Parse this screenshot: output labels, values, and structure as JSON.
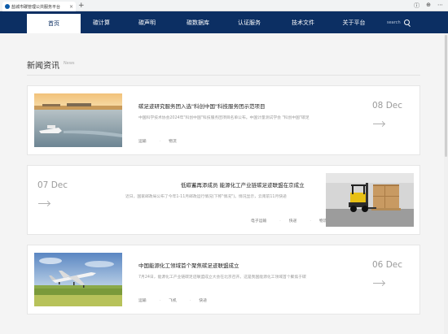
{
  "browser": {
    "tab_title": "盐城市碳管理公共服务平台",
    "tab_close": "×",
    "new_tab": "+",
    "icons": [
      "info-icon",
      "globe-icon",
      "more-icon"
    ]
  },
  "nav": {
    "items": [
      {
        "label": "首页",
        "active": true
      },
      {
        "label": "碳计算"
      },
      {
        "label": "碳声明"
      },
      {
        "label": "碳数据库"
      },
      {
        "label": "认证服务"
      },
      {
        "label": "技术文件"
      },
      {
        "label": "关于平台"
      }
    ],
    "search_placeholder": "search"
  },
  "section": {
    "title": "新闻资讯",
    "subtitle": "News"
  },
  "articles": [
    {
      "title": "碳足迹研究服务团入选\"科创中国\"科技服务团示范项目",
      "desc": "中国科学技术协会2024年\"科创中国\"科技服务团项目名单公布。中国计量测试学会 \"科创中国\"碳足",
      "tags": [
        "运输",
        "物流"
      ],
      "date": "08 Dec"
    },
    {
      "title": "低碳蓄再添成员 能源化工产业链碳足迹联盟在京成立",
      "desc": "近日，国家邮政局公布了今年1-11月邮政运行情况(下称\"情况\")。情况显示，云南前11月快递",
      "tags": [
        "电子运输",
        "快递",
        "物流"
      ],
      "date": "07 Dec"
    },
    {
      "title": "中国能源化工领域首个聚焦碳足迹联盟成立",
      "desc": "7月24日，能源化工产业链碳足迹联盟成立大会在北京召开。这是我国能源化工领域首个聚焦于碳",
      "tags": [
        "运输",
        "飞机",
        "快递"
      ],
      "date": "06 Dec"
    }
  ]
}
